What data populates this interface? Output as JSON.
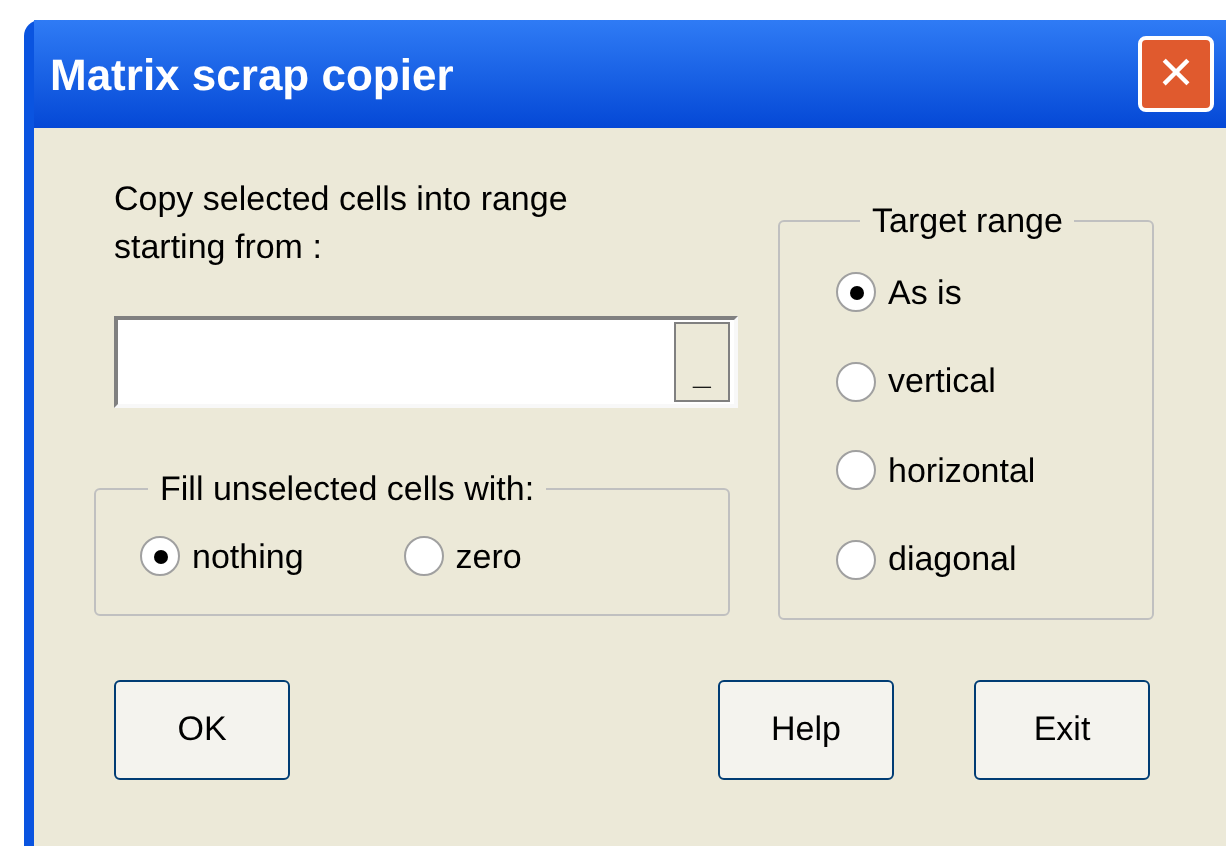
{
  "window": {
    "title": "Matrix scrap copier",
    "close_button": "×"
  },
  "range_prompt": "Copy selected cells into range starting from :",
  "range_field": {
    "collapse_button": "_"
  },
  "fill_group": {
    "title": "Fill unselected cells with:",
    "options": [
      {
        "label": "nothing",
        "selected": true
      },
      {
        "label": "zero",
        "selected": false
      }
    ]
  },
  "target_group": {
    "title": "Target range",
    "options": [
      {
        "label": "As is",
        "selected": true
      },
      {
        "label": "vertical",
        "selected": false
      },
      {
        "label": "horizontal",
        "selected": false
      },
      {
        "label": "diagonal",
        "selected": false
      }
    ]
  },
  "buttons": [
    "OK",
    "Help",
    "Exit"
  ]
}
